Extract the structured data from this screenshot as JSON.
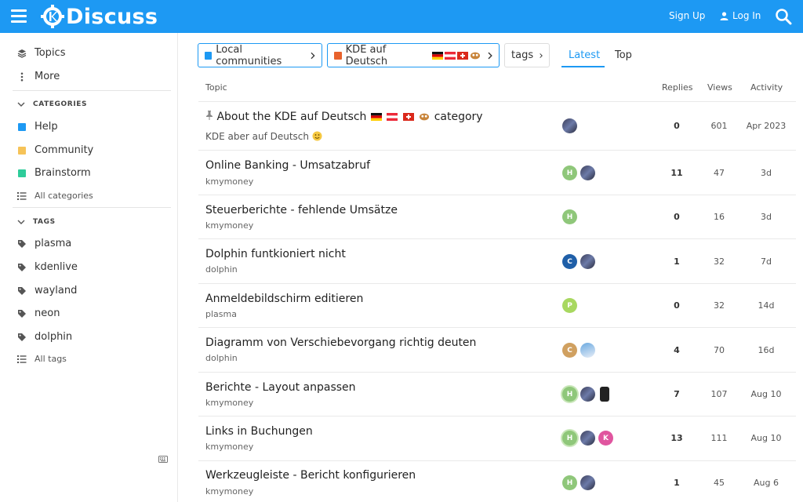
{
  "header": {
    "logo_text": "Discuss",
    "signup_label": "Sign Up",
    "login_label": "Log In"
  },
  "sidebar": {
    "topics_label": "Topics",
    "more_label": "More",
    "categories_heading": "CATEGORIES",
    "categories": [
      {
        "label": "Help",
        "color": "#1d99f3"
      },
      {
        "label": "Community",
        "color": "#f6c358"
      },
      {
        "label": "Brainstorm",
        "color": "#2ecc9a"
      }
    ],
    "all_categories_label": "All categories",
    "tags_heading": "TAGS",
    "tags": [
      "plasma",
      "kdenlive",
      "wayland",
      "neon",
      "dolphin"
    ],
    "all_tags_label": "All tags"
  },
  "breadcrumbs": {
    "parent_label": "Local communities",
    "parent_color": "#1d99f3",
    "category_label": "KDE auf Deutsch",
    "category_color": "#e8622c",
    "tags_label": "tags"
  },
  "nav": {
    "latest_label": "Latest",
    "top_label": "Top"
  },
  "table": {
    "headers": {
      "topic": "Topic",
      "replies": "Replies",
      "views": "Views",
      "activity": "Activity"
    },
    "pinned": {
      "title_prefix": "About the KDE auf Deutsch",
      "title_suffix": "category",
      "excerpt": "KDE aber auf Deutsch",
      "replies": "0",
      "views": "601",
      "activity": "Apr 2023"
    },
    "rows": [
      {
        "title": "Online Banking - Umsatzabruf",
        "tag": "kmymoney",
        "replies": "11",
        "views": "47",
        "activity": "3d",
        "posters": [
          "H",
          "img"
        ]
      },
      {
        "title": "Steuerberichte - fehlende Umsätze",
        "tag": "kmymoney",
        "replies": "0",
        "views": "16",
        "activity": "3d",
        "posters": [
          "H"
        ]
      },
      {
        "title": "Dolphin funtkioniert nicht",
        "tag": "dolphin",
        "replies": "1",
        "views": "32",
        "activity": "7d",
        "posters": [
          "C",
          "img"
        ]
      },
      {
        "title": "Anmeldebildschirm editieren",
        "tag": "plasma",
        "replies": "0",
        "views": "32",
        "activity": "14d",
        "posters": [
          "P"
        ]
      },
      {
        "title": "Diagramm von Verschiebevorgang richtig deuten",
        "tag": "dolphin",
        "replies": "4",
        "views": "70",
        "activity": "16d",
        "posters": [
          "C",
          "img"
        ]
      },
      {
        "title": "Berichte - Layout anpassen",
        "tag": "kmymoney",
        "replies": "7",
        "views": "107",
        "activity": "Aug 10",
        "posters": [
          "H",
          "img",
          "img"
        ]
      },
      {
        "title": "Links in Buchungen",
        "tag": "kmymoney",
        "replies": "13",
        "views": "111",
        "activity": "Aug 10",
        "posters": [
          "H",
          "img",
          "K"
        ]
      },
      {
        "title": "Werkzeugleiste - Bericht konfigurieren",
        "tag": "kmymoney",
        "replies": "1",
        "views": "45",
        "activity": "Aug 6",
        "posters": [
          "H",
          "img"
        ]
      }
    ]
  },
  "colors": {
    "brand": "#1d99f3",
    "avatar_h": "#8fc77a",
    "avatar_c_dark": "#1f5fa8",
    "avatar_c_tan": "#d0a060",
    "avatar_p": "#a8d860",
    "avatar_k": "#e0559f"
  }
}
